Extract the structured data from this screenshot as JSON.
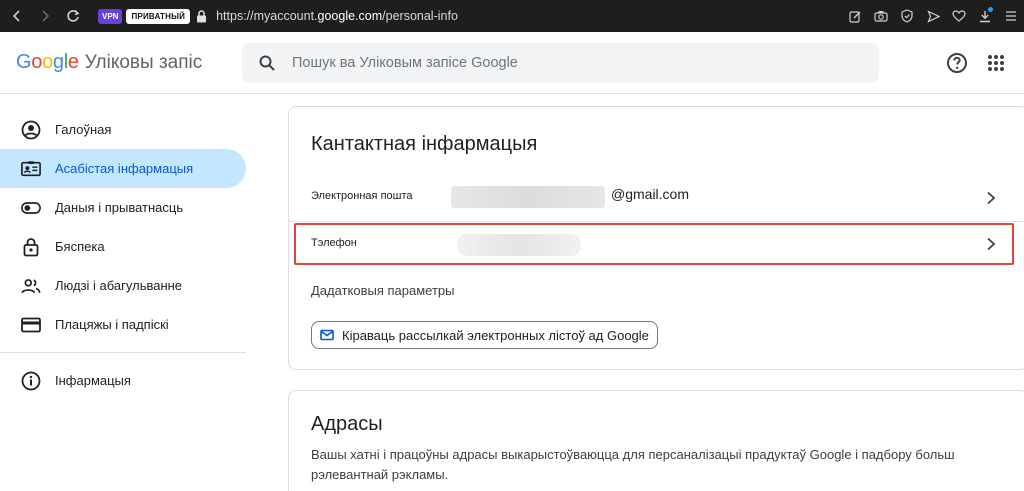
{
  "browser": {
    "vpn_label": "VPN",
    "private_label": "ПРИВАТНЫЙ",
    "url_prefix": "https://myaccount.",
    "url_domain": "google.com",
    "url_path": "/personal-info"
  },
  "header": {
    "logo_letters": [
      {
        "ch": "G",
        "color": "#4285F4"
      },
      {
        "ch": "o",
        "color": "#EA4335"
      },
      {
        "ch": "o",
        "color": "#FBBC05"
      },
      {
        "ch": "g",
        "color": "#4285F4"
      },
      {
        "ch": "l",
        "color": "#34A853"
      },
      {
        "ch": "e",
        "color": "#EA4335"
      }
    ],
    "product_name": "Уліковы запіс",
    "search_placeholder": "Пошук ва Уліковым запісе Google"
  },
  "sidebar": {
    "items": [
      {
        "label": "Галоўная",
        "icon": "account-circle-icon",
        "active": false
      },
      {
        "label": "Асабістая інфармацыя",
        "icon": "id-card-icon",
        "active": true
      },
      {
        "label": "Даныя і прыватнасць",
        "icon": "toggle-icon",
        "active": false
      },
      {
        "label": "Бяспека",
        "icon": "lock-icon",
        "active": false
      },
      {
        "label": "Людзі і абагульванне",
        "icon": "people-icon",
        "active": false
      },
      {
        "label": "Плацяжы і падпіскі",
        "icon": "credit-card-icon",
        "active": false
      }
    ],
    "info_item": {
      "label": "Інфармацыя",
      "icon": "info-icon"
    }
  },
  "contact_card": {
    "title": "Кантактная інфармацыя",
    "email_label": "Электронная пошта",
    "email_suffix": "@gmail.com",
    "phone_label": "Тэлефон",
    "extra_label": "Дадатковыя параметры",
    "newsletter_button": "Кіраваць рассылкай электронных лістоў ад Google"
  },
  "address_card": {
    "title": "Адрасы",
    "description": "Вашы хатні і працоўны адрасы выкарыстоўваюцца для персаналізацыі прадуктаў Google і падбору больш рэлевантнай рэкламы."
  },
  "colors": {
    "accent": "#0b57d0",
    "active_bg": "#c2e7ff",
    "highlight": "#e0443e",
    "vpn": "#6b3fd9"
  }
}
